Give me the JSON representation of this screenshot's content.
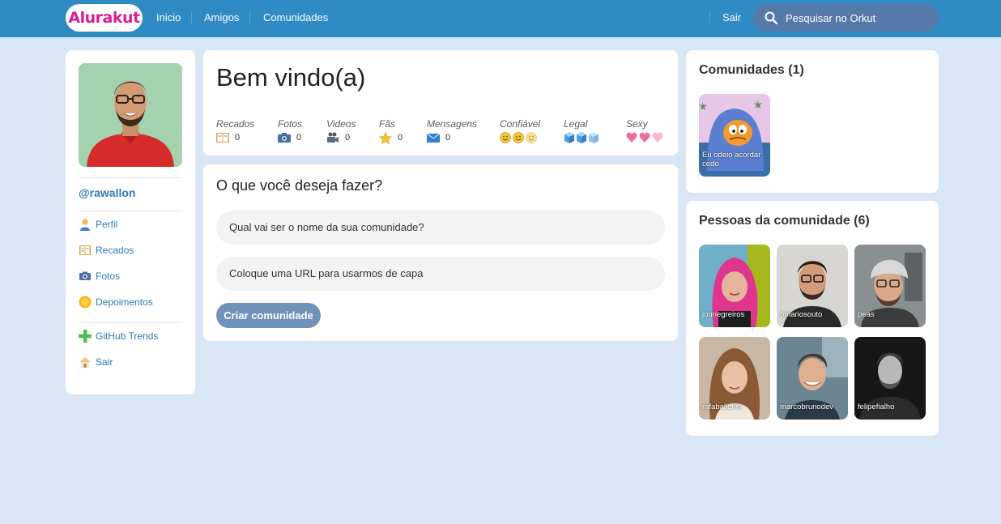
{
  "header": {
    "logo": "Alurakut",
    "nav": [
      "Inicio",
      "Amigos",
      "Comunidades"
    ],
    "logout": "Sair",
    "search_placeholder": "Pesquisar no Orkut"
  },
  "profile": {
    "username": "@rawallon",
    "menu": [
      {
        "label": "Perfil",
        "icon": "user-icon"
      },
      {
        "label": "Recados",
        "icon": "book-icon"
      },
      {
        "label": "Fotos",
        "icon": "camera-icon"
      },
      {
        "label": "Depoimentos",
        "icon": "sun-icon"
      },
      {
        "label": "GitHub Trends",
        "icon": "plus-icon"
      },
      {
        "label": "Sair",
        "icon": "house-icon"
      }
    ]
  },
  "welcome": {
    "title": "Bem vindo(a)",
    "stats": [
      {
        "label": "Recados",
        "value": "0",
        "icon": "book-icon"
      },
      {
        "label": "Fotos",
        "value": "0",
        "icon": "camera-icon"
      },
      {
        "label": "Videos",
        "value": "0",
        "icon": "video-camera-icon"
      },
      {
        "label": "Fãs",
        "value": "0",
        "icon": "star-icon"
      },
      {
        "label": "Mensagens",
        "value": "0",
        "icon": "envelope-icon"
      }
    ],
    "ratings": [
      {
        "label": "Confiável",
        "icon": "smiley-icon",
        "count": 3
      },
      {
        "label": "Legal",
        "icon": "ice-cube-icon",
        "count": 3
      },
      {
        "label": "Sexy",
        "icon": "heart-icon",
        "count": 3
      }
    ]
  },
  "form": {
    "title": "O que você deseja fazer?",
    "name_placeholder": "Qual vai ser o nome da sua comunidade?",
    "cover_placeholder": "Coloque uma URL para usarmos de capa",
    "submit": "Criar comunidade"
  },
  "communities": {
    "title": "Comunidades (1)",
    "items": [
      {
        "label": "Eu odeio acordar cedo"
      }
    ]
  },
  "people": {
    "title": "Pessoas da comunidade (6)",
    "items": [
      {
        "label": "juunegreiros"
      },
      {
        "label": "omariosouto"
      },
      {
        "label": "peas"
      },
      {
        "label": "rafaballerini"
      },
      {
        "label": "marcobrunodev"
      },
      {
        "label": "felipefialho"
      }
    ]
  },
  "colors": {
    "header": "#308bc5",
    "background": "#d9e6f6",
    "link": "#2e7bb4",
    "logo": "#d81d99",
    "button": "#6f92bb"
  }
}
